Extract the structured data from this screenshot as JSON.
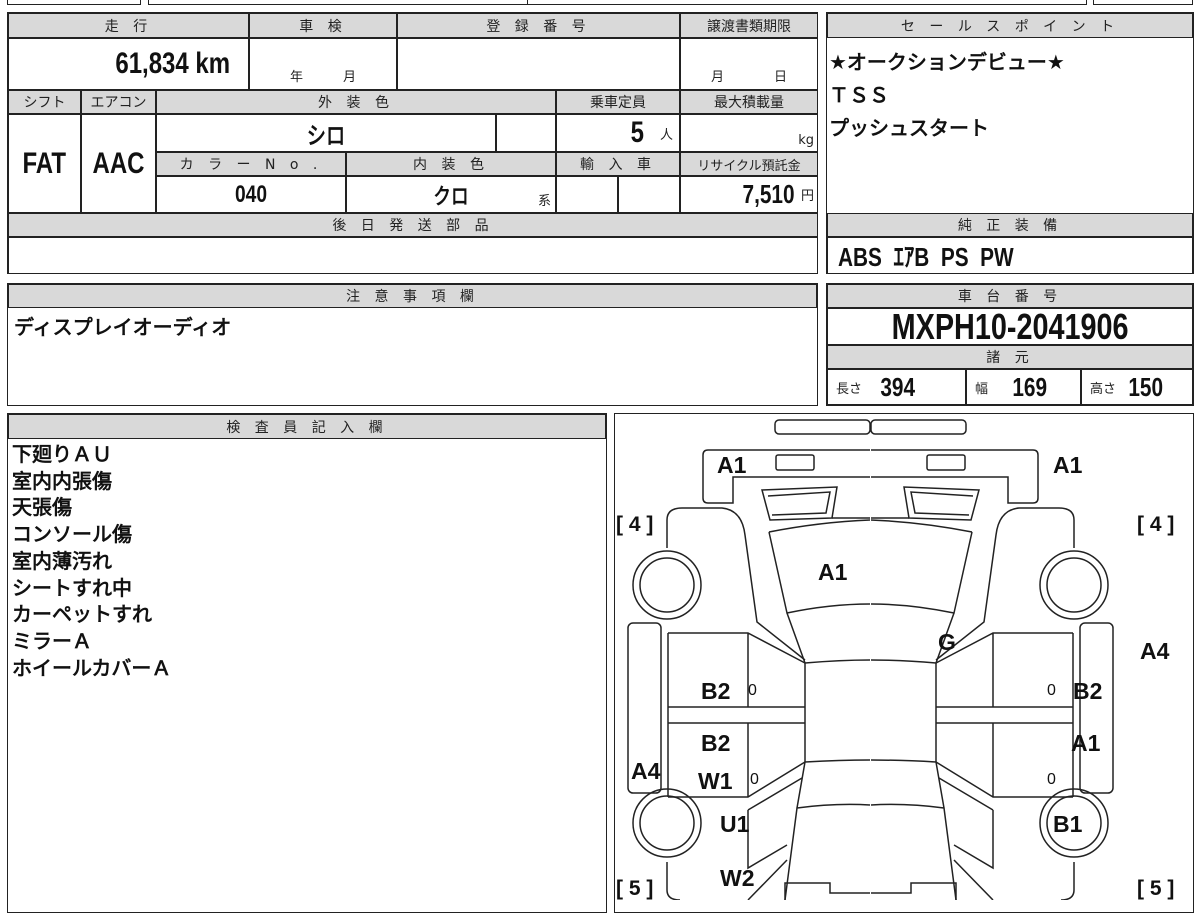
{
  "left_table": {
    "mileage_header": "走 行",
    "mileage_value": "61,834",
    "mileage_unit": "km",
    "inspection_header": "車 検",
    "inspection_year": "年",
    "inspection_month": "月",
    "registration_header": "登 録 番 号",
    "transfer_header": "譲渡書類期限",
    "transfer_month": "月",
    "transfer_day": "日",
    "shift_header": "シフト",
    "shift_value": "FAT",
    "ac_header": "エアコン",
    "ac_value": "AAC",
    "exterior_color_header": "外 装 色",
    "exterior_color_value": "シロ",
    "capacity_header": "乗車定員",
    "capacity_value": "5",
    "capacity_unit": "人",
    "max_load_header": "最大積載量",
    "max_load_unit": "kg",
    "color_no_header": "カ ラ ー N o .",
    "color_no_value": "040",
    "interior_color_header": "内 装 色",
    "interior_color_value": "クロ",
    "interior_color_suffix": "系",
    "import_header": "輸 入 車",
    "recycle_header": "リサイクル預託金",
    "recycle_value": "7,510",
    "recycle_unit": "円",
    "later_parts_header": "後 日 発 送 部 品"
  },
  "sales_points": {
    "header": "セ ー ル ス ポ イ ン ト",
    "lines": [
      "★オークションデビュー★",
      "ＴＳＳ",
      "プッシュスタート"
    ]
  },
  "equipment": {
    "header": "純 正 装 備",
    "value": "ABS  ｴｱB  PS  PW"
  },
  "notes": {
    "header": "注 意 事 項 欄",
    "value": "ディスプレイオーディオ"
  },
  "chassis": {
    "header": "車 台 番 号",
    "value": "MXPH10-2041906",
    "spec_header": "諸 元",
    "length_label": "長さ",
    "length_value": "394",
    "width_label": "幅",
    "width_value": "169",
    "height_label": "高さ",
    "height_value": "150"
  },
  "inspector": {
    "header": "検 査 員 記 入 欄",
    "lines": [
      "下廻りＡＵ",
      "室内内張傷",
      "天張傷",
      "コンソール傷",
      "室内薄汚れ",
      "シートすれ中",
      "カーペットすれ",
      "ミラーＡ",
      "ホイールカバーＡ"
    ]
  },
  "diagram": {
    "labels": [
      "A1",
      "A1",
      "[ 4 ]",
      "[ 4 ]",
      "A1",
      "G",
      "A4",
      "B2",
      "0",
      "0",
      "B2",
      "B2",
      "A1",
      "A4",
      "W1",
      "0",
      "0",
      "U1",
      "B1",
      "[ 5 ]",
      "W2",
      "[ 5 ]"
    ]
  }
}
